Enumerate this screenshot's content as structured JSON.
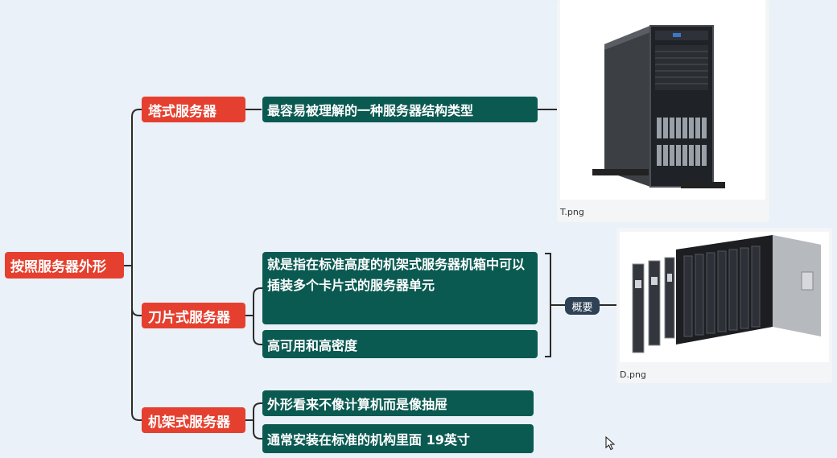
{
  "mindmap": {
    "root": "按照服务器外形",
    "categories": [
      {
        "label": "塔式服务器",
        "items": [
          "最容易被理解的一种服务器结构类型"
        ]
      },
      {
        "label": "刀片式服务器",
        "items": [
          "就是指在标准高度的机架式服务器机箱中可以插装多个卡片式的服务器单元",
          "高可用和高密度"
        ]
      },
      {
        "label": "机架式服务器",
        "items": [
          "外形看来不像计算机而是像抽屉",
          "通常安装在标准的机构里面  19英寸"
        ]
      }
    ],
    "summary_label": "概要",
    "images": [
      {
        "caption": "T.png"
      },
      {
        "caption": "D.png"
      }
    ]
  },
  "colors": {
    "background": "#eaf1f8",
    "category_fill": "#e5402f",
    "leaf_fill": "#0b5a52",
    "summary_fill": "#2e4155",
    "line": "#2b2b2b"
  }
}
